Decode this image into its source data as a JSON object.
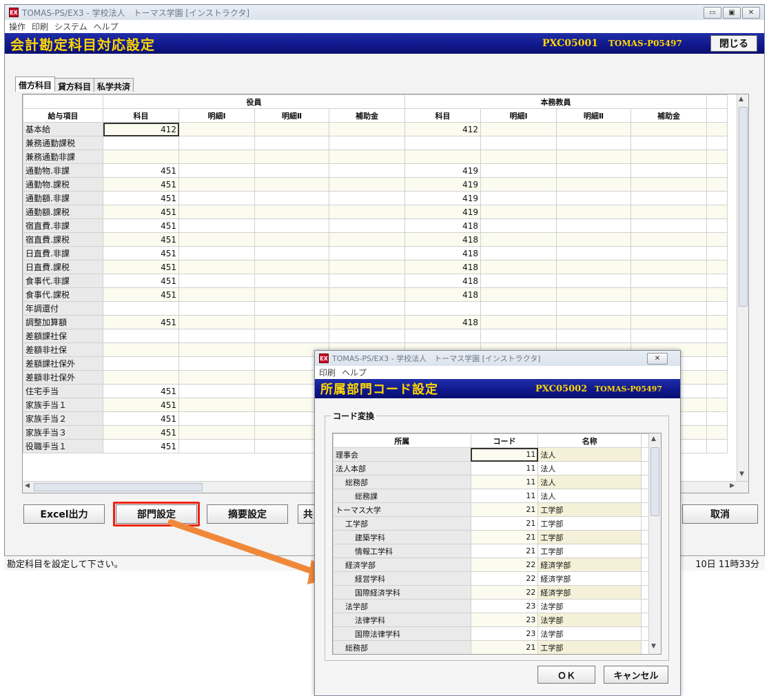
{
  "main": {
    "window_title": "TOMAS-PS/EX3 - 学校法人　トーマス学園 [インストラクタ]",
    "icon_text": "EX",
    "menus": [
      "操作",
      "印刷",
      "システム",
      "ヘルプ"
    ],
    "header_title": "会計勘定科目対応設定",
    "screen_id": "PXC05001",
    "user_id": "TOMAS-P05497",
    "close_label": "閉じる",
    "tabs": [
      "借方科目",
      "貸方科目",
      "私学共済"
    ],
    "group1": "役員",
    "group2": "本務教員",
    "col_item": "給与項目",
    "cols": [
      "科目",
      "明細Ⅰ",
      "明細Ⅱ",
      "補助金",
      "科目",
      "明細Ⅰ",
      "明細Ⅱ",
      "補助金"
    ],
    "rows": [
      {
        "name": "基本給",
        "a": "412",
        "b": "412"
      },
      {
        "name": "兼務通勤課税",
        "a": "",
        "b": ""
      },
      {
        "name": "兼務通勤非課",
        "a": "",
        "b": ""
      },
      {
        "name": "通勤物.非課",
        "a": "451",
        "b": "419"
      },
      {
        "name": "通勤物.課税",
        "a": "451",
        "b": "419"
      },
      {
        "name": "通勤額.非課",
        "a": "451",
        "b": "419"
      },
      {
        "name": "通勤額.課税",
        "a": "451",
        "b": "419"
      },
      {
        "name": "宿直費.非課",
        "a": "451",
        "b": "418"
      },
      {
        "name": "宿直費.課税",
        "a": "451",
        "b": "418"
      },
      {
        "name": "日直費.非課",
        "a": "451",
        "b": "418"
      },
      {
        "name": "日直費.課税",
        "a": "451",
        "b": "418"
      },
      {
        "name": "食事代.非課",
        "a": "451",
        "b": "418"
      },
      {
        "name": "食事代.課税",
        "a": "451",
        "b": "418"
      },
      {
        "name": "年調還付",
        "a": "",
        "b": ""
      },
      {
        "name": "調整加算額",
        "a": "451",
        "b": "418"
      },
      {
        "name": "差額課社保",
        "a": "",
        "b": ""
      },
      {
        "name": "差額非社保",
        "a": "",
        "b": ""
      },
      {
        "name": "差額課社保外",
        "a": "",
        "b": ""
      },
      {
        "name": "差額非社保外",
        "a": "",
        "b": ""
      },
      {
        "name": "住宅手当",
        "a": "451",
        "b": ""
      },
      {
        "name": "家族手当１",
        "a": "451",
        "b": ""
      },
      {
        "name": "家族手当２",
        "a": "451",
        "b": ""
      },
      {
        "name": "家族手当３",
        "a": "451",
        "b": ""
      },
      {
        "name": "役職手当１",
        "a": "451",
        "b": ""
      }
    ],
    "buttons": {
      "excel": "Excel出力",
      "dept": "部門設定",
      "summary": "摘要設定",
      "share": "共",
      "cancel": "取消"
    },
    "status_text": "勘定科目を設定して下さい。",
    "status_time": "10日 11時33分"
  },
  "dialog": {
    "window_title": "TOMAS-PS/EX3 - 学校法人　トーマス学園 [インストラクタ]",
    "menus": [
      "印刷",
      "ヘルプ"
    ],
    "header_title": "所属部門コード設定",
    "screen_id": "PXC05002",
    "user_id": "TOMAS-P05497",
    "group_title": "コード変換",
    "cols": [
      "所属",
      "コード",
      "名称"
    ],
    "rows": [
      {
        "dept": "理事会",
        "indent": 0,
        "code": "11",
        "name": "法人"
      },
      {
        "dept": "法人本部",
        "indent": 0,
        "code": "11",
        "name": "法人"
      },
      {
        "dept": "総務部",
        "indent": 1,
        "code": "11",
        "name": "法人"
      },
      {
        "dept": "総務課",
        "indent": 2,
        "code": "11",
        "name": "法人"
      },
      {
        "dept": "トーマス大学",
        "indent": 0,
        "code": "21",
        "name": "工学部"
      },
      {
        "dept": "工学部",
        "indent": 1,
        "code": "21",
        "name": "工学部"
      },
      {
        "dept": "建築学科",
        "indent": 2,
        "code": "21",
        "name": "工学部"
      },
      {
        "dept": "情報工学科",
        "indent": 2,
        "code": "21",
        "name": "工学部"
      },
      {
        "dept": "経済学部",
        "indent": 1,
        "code": "22",
        "name": "経済学部"
      },
      {
        "dept": "経営学科",
        "indent": 2,
        "code": "22",
        "name": "経済学部"
      },
      {
        "dept": "国際経済学科",
        "indent": 2,
        "code": "22",
        "name": "経済学部"
      },
      {
        "dept": "法学部",
        "indent": 1,
        "code": "23",
        "name": "法学部"
      },
      {
        "dept": "法律学科",
        "indent": 2,
        "code": "23",
        "name": "法学部"
      },
      {
        "dept": "国際法律学科",
        "indent": 2,
        "code": "23",
        "name": "法学部"
      },
      {
        "dept": "総務部",
        "indent": 1,
        "code": "21",
        "name": "工学部"
      }
    ],
    "ok_label": "ＯＫ",
    "cancel_label": "キャンセル"
  },
  "colors": {
    "header_bg": "#10178a",
    "header_text": "#ffd700",
    "highlight": "#e21111",
    "arrow": "#f0883a"
  }
}
